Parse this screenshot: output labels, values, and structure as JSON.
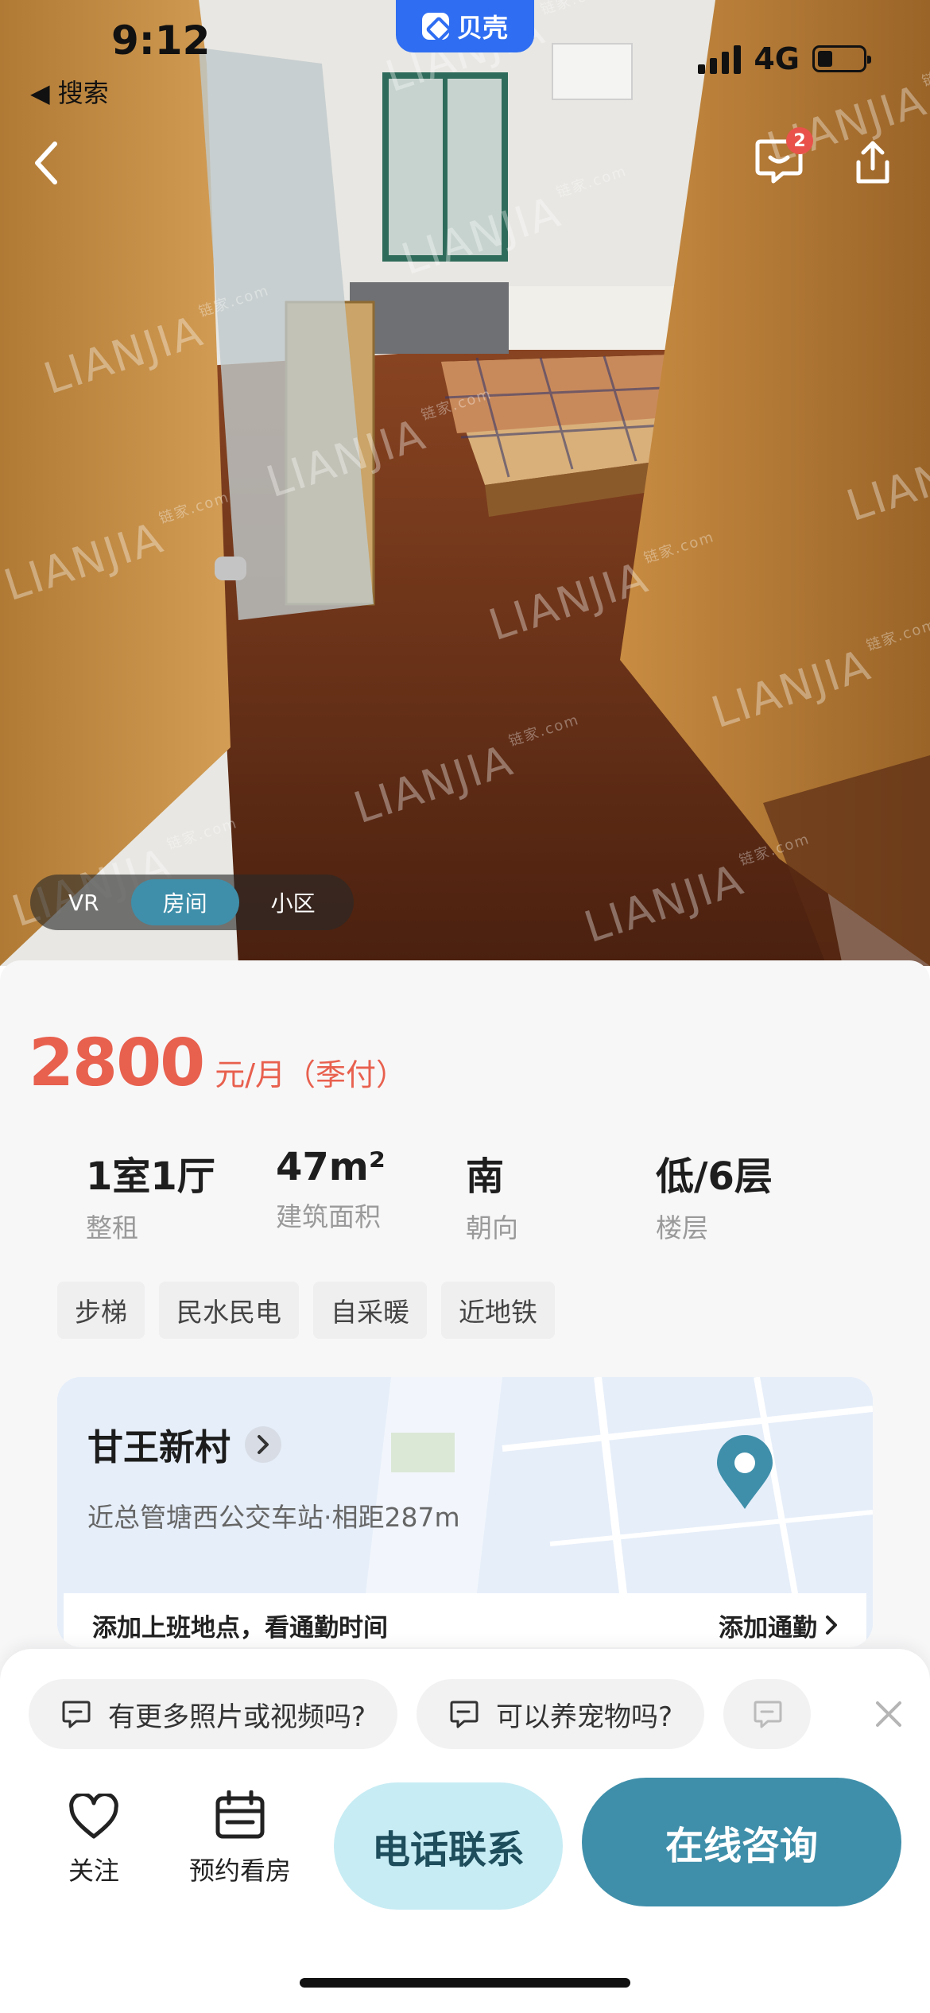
{
  "status_bar": {
    "time": "9:12",
    "back_app": "◀ 搜索",
    "network": "4G"
  },
  "brand": {
    "name": "贝壳"
  },
  "header": {
    "message_badge": "2"
  },
  "watermark": {
    "text": "LIANJIA",
    "sub": "链家.com"
  },
  "media_tabs": [
    {
      "label": "VR",
      "active": false
    },
    {
      "label": "房间",
      "active": true
    },
    {
      "label": "小区",
      "active": false
    }
  ],
  "price": {
    "amount": "2800",
    "unit": "元/月（季付）"
  },
  "facts": [
    {
      "value": "1室1厅",
      "label": "整租"
    },
    {
      "value": "47m²",
      "label": "建筑面积"
    },
    {
      "value": "南",
      "label": "朝向"
    },
    {
      "value": "低/6层",
      "label": "楼层"
    }
  ],
  "tags": [
    "步梯",
    "民水民电",
    "自采暖",
    "近地铁"
  ],
  "community": {
    "name": "甘王新村",
    "transit": "近总管塘西公交车站·相距287m",
    "commute_prompt": "添加上班地点，看通勤时间",
    "commute_action": "添加通勤"
  },
  "faq": [
    "有更多照片或视频吗?",
    "可以养宠物吗?"
  ],
  "actions": {
    "follow": "关注",
    "schedule": "预约看房",
    "call": "电话联系",
    "online": "在线咨询"
  },
  "colors": {
    "accent": "#3f8faa",
    "price": "#e8604e",
    "brand": "#2f6ef2",
    "badge": "#e8524a"
  }
}
